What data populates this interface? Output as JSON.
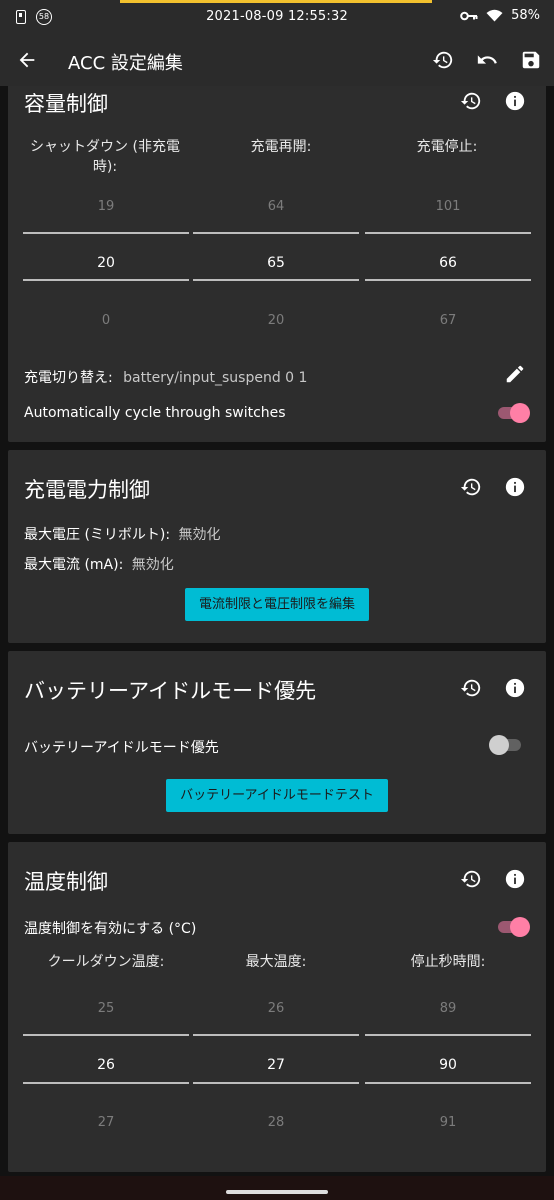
{
  "status_bar": {
    "badge_text": "58",
    "time": "2021-08-09 12:55:32",
    "battery": "58%"
  },
  "app_bar": {
    "title": "ACC 設定編集"
  },
  "capacity_card": {
    "title": "容量制御",
    "columns": [
      {
        "header": "シャットダウン (非充電時):",
        "above": "19",
        "selected": "20",
        "below": "0"
      },
      {
        "header": "充電再開:",
        "above": "64",
        "selected": "65",
        "below": "20"
      },
      {
        "header": "充電停止:",
        "above": "101",
        "selected": "66",
        "below": "67"
      }
    ],
    "switch_label": "充電切り替え:",
    "switch_value": "battery/input_suspend 0 1",
    "auto_cycle_label": "Automatically cycle through switches",
    "auto_cycle_on": true
  },
  "power_card": {
    "title": "充電電力制御",
    "voltage_label": "最大電圧 (ミリボルト):",
    "voltage_value": "無効化",
    "current_label": "最大電流 (mA):",
    "current_value": "無効化",
    "edit_button": "電流制限と電圧制限を編集"
  },
  "idle_card": {
    "title": "バッテリーアイドルモード優先",
    "toggle_label": "バッテリーアイドルモード優先",
    "toggle_on": false,
    "test_button": "バッテリーアイドルモードテスト"
  },
  "temp_card": {
    "title": "温度制御",
    "enable_label": "温度制御を有効にする (°C)",
    "enable_on": true,
    "columns": [
      {
        "header": "クールダウン温度:",
        "above": "25",
        "selected": "26",
        "below": "27"
      },
      {
        "header": "最大温度:",
        "above": "26",
        "selected": "27",
        "below": "28"
      },
      {
        "header": "停止秒時間:",
        "above": "89",
        "selected": "90",
        "below": "91"
      }
    ]
  },
  "colors": {
    "accent_button": "#00bcd4",
    "switch_on": "#ff7fa6",
    "card_bg": "#2d2d2d",
    "status_accent": "#f2c12e"
  }
}
